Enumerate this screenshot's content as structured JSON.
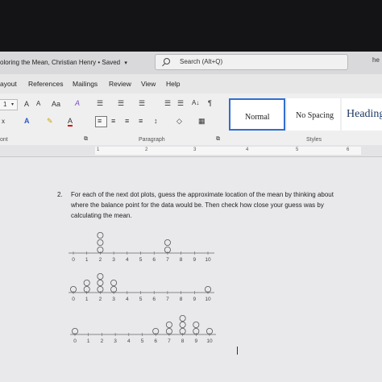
{
  "app": {
    "doc_title": "oloring the Mean, Christian Henry • Saved",
    "title_chevron": "▾",
    "search_placeholder": "Search (Alt+Q)",
    "user_stub": "he"
  },
  "menu": {
    "items": [
      "ayout",
      "References",
      "Mailings",
      "Review",
      "View",
      "Help"
    ]
  },
  "ribbon": {
    "font_size_stub": "1",
    "grow_font": "A",
    "shrink_font": "A",
    "change_case": "Aa",
    "clear_format": "A",
    "subscript_stub": "x",
    "text_effects": "A",
    "highlight": "✎",
    "font_color": "A",
    "pilcrow": "¶",
    "sort": "A↓",
    "groups": {
      "font": "ont",
      "paragraph": "Paragraph",
      "styles": "Styles"
    },
    "styles": [
      {
        "name": "Normal",
        "selected": true
      },
      {
        "name": "No Spacing",
        "selected": false
      },
      {
        "name": "Heading",
        "selected": false
      }
    ]
  },
  "ruler": {
    "numbers": [
      "1",
      "2",
      "3",
      "4",
      "5",
      "6"
    ]
  },
  "document": {
    "question_number": "2.",
    "question_lines": [
      "For each of the next dot plots, guess the approximate location of the mean by thinking about",
      "where the balance point for the data would be. Then check how close your guess was by",
      "calculating the mean."
    ]
  },
  "chart_data": [
    {
      "type": "scatter",
      "title": "",
      "x": [
        2,
        2,
        2,
        7,
        7
      ],
      "y": [
        1,
        2,
        3,
        1,
        2
      ],
      "xlim": [
        0,
        10
      ],
      "tick_labels": [
        "0",
        "1",
        "2",
        "3",
        "4",
        "5",
        "6",
        "7",
        "8",
        "9",
        "10"
      ]
    },
    {
      "type": "scatter",
      "title": "",
      "x": [
        0,
        1,
        1,
        2,
        2,
        2,
        3,
        3,
        10
      ],
      "y": [
        1,
        1,
        2,
        1,
        2,
        3,
        1,
        2,
        1
      ],
      "xlim": [
        0,
        10
      ],
      "tick_labels": [
        "0",
        "1",
        "2",
        "3",
        "4",
        "5",
        "6",
        "7",
        "8",
        "9",
        "10"
      ]
    },
    {
      "type": "scatter",
      "title": "",
      "x": [
        0,
        6,
        7,
        7,
        8,
        8,
        8,
        9,
        9,
        10
      ],
      "y": [
        1,
        1,
        1,
        2,
        1,
        2,
        3,
        1,
        2,
        1
      ],
      "xlim": [
        0,
        10
      ],
      "tick_labels": [
        "0",
        "1",
        "2",
        "3",
        "4",
        "5",
        "6",
        "7",
        "8",
        "9",
        "10"
      ]
    }
  ]
}
